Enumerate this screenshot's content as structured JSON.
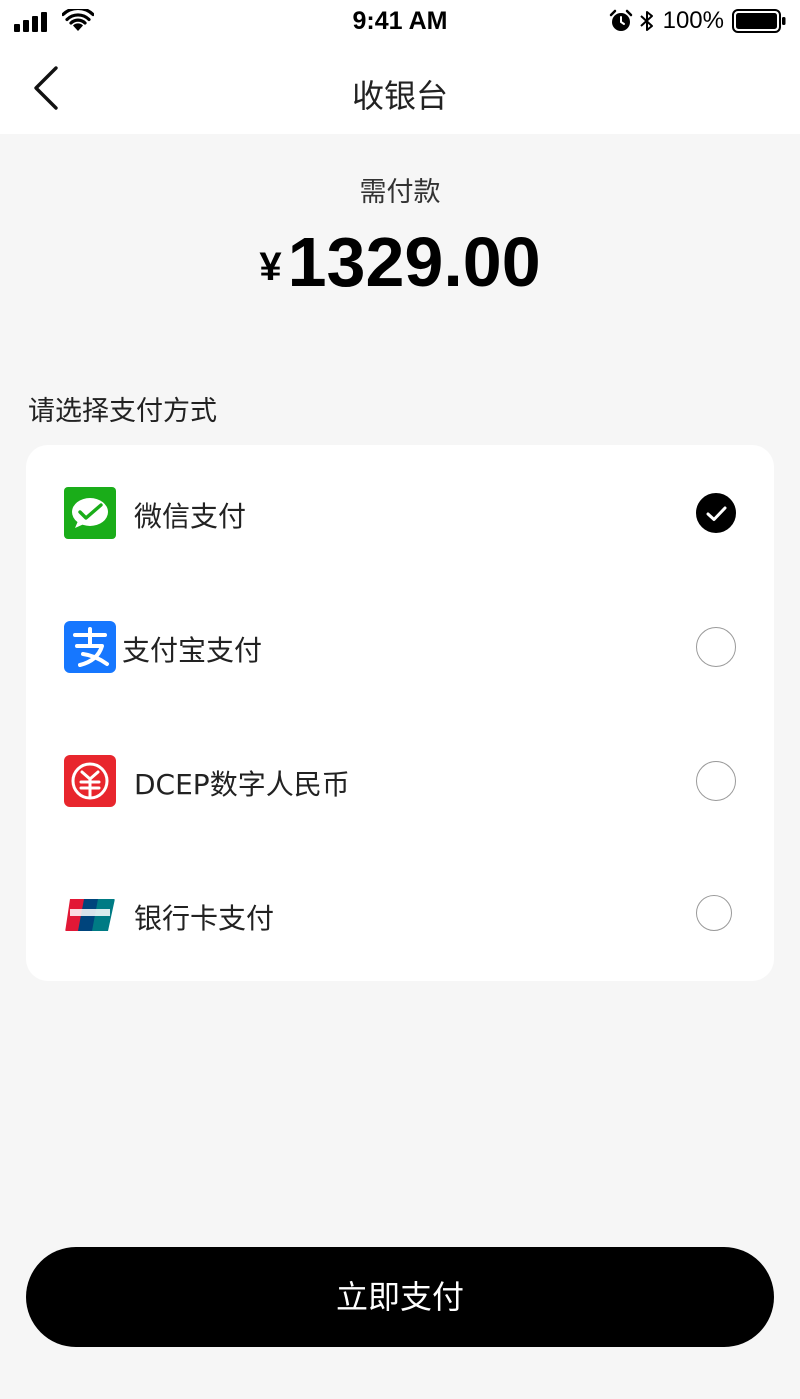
{
  "status_bar": {
    "time": "9:41 AM",
    "battery": "100%",
    "icons": [
      "signal-icon",
      "wifi-icon",
      "alarm-icon",
      "bluetooth-icon",
      "battery-icon"
    ]
  },
  "nav": {
    "title": "收银台",
    "back_icon": "chevron-left-icon"
  },
  "payment": {
    "amount_label": "需付款",
    "currency": "¥",
    "amount": "1329.00"
  },
  "methods_title": "请选择支付方式",
  "methods": [
    {
      "label": "微信支付",
      "icon": "wechat-pay-icon",
      "selected": true
    },
    {
      "label": "支付宝支付",
      "icon": "alipay-icon",
      "selected": false
    },
    {
      "label": "DCEP数字人民币",
      "icon": "dcep-icon",
      "selected": false
    },
    {
      "label": "银行卡支付",
      "icon": "unionpay-icon",
      "selected": false
    }
  ],
  "pay_button": "立即支付",
  "colors": {
    "wechat": "#1aad19",
    "alipay": "#1677ff",
    "dcep": "#e8262d",
    "button": "#000000",
    "background": "#f6f6f6"
  }
}
